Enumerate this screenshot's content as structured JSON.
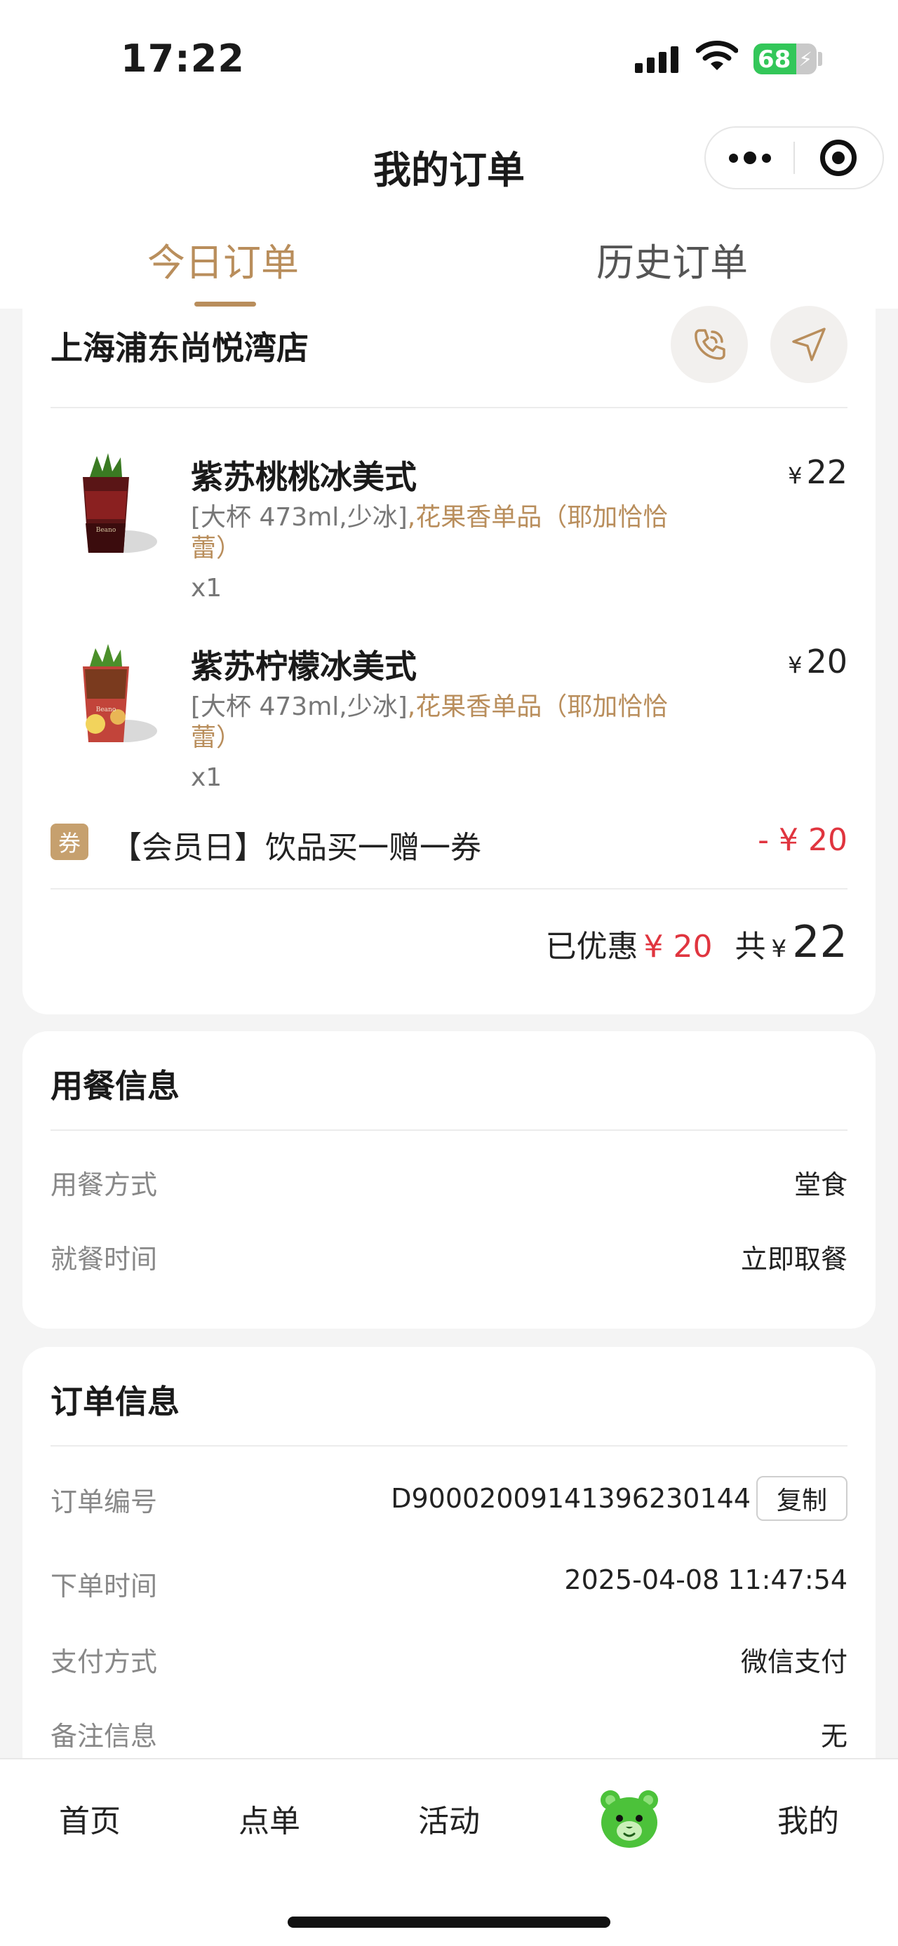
{
  "status_bar": {
    "time": "17:22",
    "battery": "68",
    "battery_level": 0.68
  },
  "header": {
    "title": "我的订单"
  },
  "tabs": [
    {
      "label": "今日订单",
      "active": true
    },
    {
      "label": "历史订单",
      "active": false
    }
  ],
  "store": {
    "name": "上海浦东尚悦湾店"
  },
  "items": [
    {
      "name": "紫苏桃桃冰美式",
      "spec": "[大杯 473ml,少冰]",
      "extra": ",花果香单品（耶加恰恰蕾）",
      "qty": "x1",
      "currency": "¥",
      "price": "22"
    },
    {
      "name": "紫苏柠檬冰美式",
      "spec": "[大杯 473ml,少冰]",
      "extra": ",花果香单品（耶加恰恰蕾）",
      "qty": "x1",
      "currency": "¥",
      "price": "20"
    }
  ],
  "coupon": {
    "tag": "券",
    "name": "【会员日】饮品买一赠一券",
    "amount": "- ¥ 20"
  },
  "summary": {
    "discount_label": "已优惠",
    "discount": "¥ 20",
    "total_label": "共",
    "currency": "¥",
    "total": "22"
  },
  "dining": {
    "title": "用餐信息",
    "rows": [
      {
        "label": "用餐方式",
        "value": "堂食"
      },
      {
        "label": "就餐时间",
        "value": "立即取餐"
      }
    ]
  },
  "order": {
    "title": "订单信息",
    "copy_label": "复制",
    "rows": [
      {
        "label": "订单编号",
        "value": "D90002009141396230144"
      },
      {
        "label": "下单时间",
        "value": "2025-04-08 11:47:54"
      },
      {
        "label": "支付方式",
        "value": "微信支付"
      },
      {
        "label": "备注信息",
        "value": "无"
      }
    ]
  },
  "tabbar": [
    {
      "label": "首页"
    },
    {
      "label": "点单"
    },
    {
      "label": "活动"
    },
    {
      "label": "",
      "icon": "bear-icon"
    },
    {
      "label": "我的"
    }
  ],
  "colors": {
    "accent": "#b98e5c",
    "red": "#e0353f"
  }
}
